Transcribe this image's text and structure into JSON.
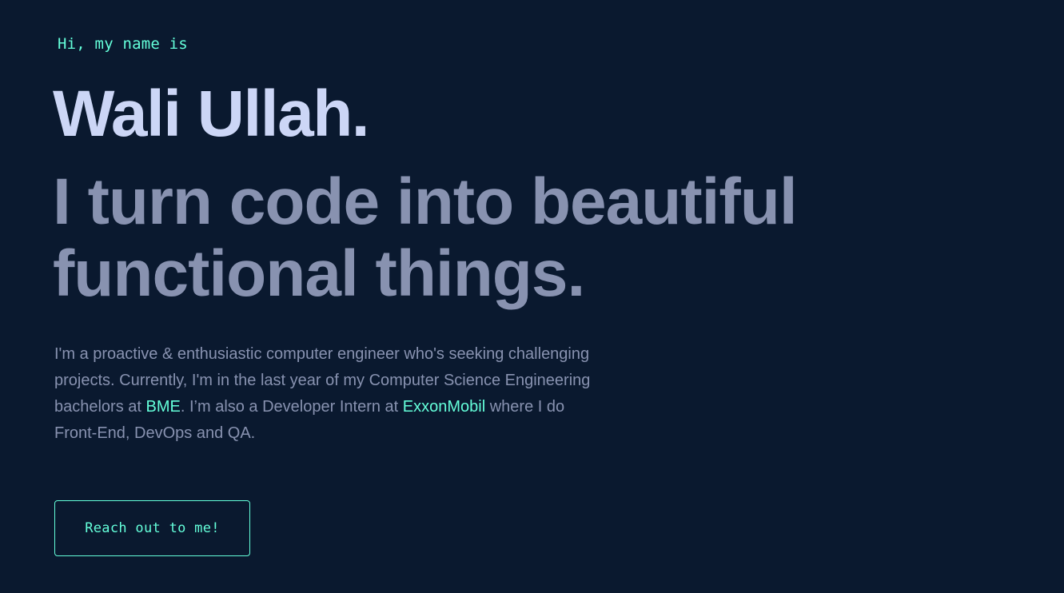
{
  "hero": {
    "intro": "Hi, my name is",
    "name": "Wali Ullah.",
    "tagline": "I turn code into beautiful functional things.",
    "bio": {
      "part1": "I'm a proactive & enthusiastic computer engineer who's seeking challenging projects. Currently, I'm in the last year of my Computer Science Engineering bachelors at ",
      "link1": "BME",
      "part2": ". I’m also a Developer Intern at ",
      "link2": "ExxonMobil",
      "part3": " where I do Front-End, DevOps and QA."
    },
    "cta_label": "Reach out to me!"
  },
  "colors": {
    "background": "#0a192f",
    "accent": "#64ffda",
    "heading": "#ccd6f6",
    "text": "#8892b0"
  }
}
